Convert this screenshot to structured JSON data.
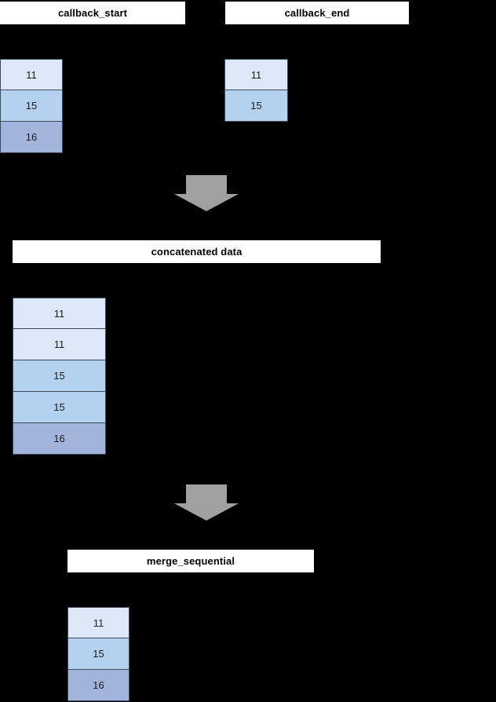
{
  "diagram": {
    "title_boxes": {
      "callback_start": "callback_start",
      "callback_end": "callback_end",
      "concatenated_data": "concatenated data",
      "merge_sequential": "merge_sequential"
    },
    "colors": {
      "background": "#000000",
      "box_fill": "#ffffff",
      "box_text": "#000000",
      "cell_border": "#3d4a5c",
      "cell_text": "#1a1a1a",
      "arrow_fill": "#a0a0a0",
      "shade_light": "#dce7f8",
      "shade_mid": "#b4d2ef",
      "shade_dark": "#a3b4dc"
    },
    "stacks": {
      "callback_start": {
        "name": "callback_start_stack",
        "cells": [
          {
            "value": "11",
            "fill": "#dce7f8"
          },
          {
            "value": "15",
            "fill": "#b4d2ef"
          },
          {
            "value": "16",
            "fill": "#a3b4dc"
          }
        ]
      },
      "callback_end": {
        "name": "callback_end_stack",
        "cells": [
          {
            "value": "11",
            "fill": "#dce7f8"
          },
          {
            "value": "15",
            "fill": "#b4d2ef"
          }
        ]
      },
      "concatenated": {
        "name": "concatenated_stack",
        "cells": [
          {
            "value": "11",
            "fill": "#dce7f8"
          },
          {
            "value": "11",
            "fill": "#dce7f8"
          },
          {
            "value": "15",
            "fill": "#b4d2ef"
          },
          {
            "value": "15",
            "fill": "#b4d2ef"
          },
          {
            "value": "16",
            "fill": "#a3b4dc"
          }
        ]
      },
      "merged": {
        "name": "merged_stack",
        "cells": [
          {
            "value": "11",
            "fill": "#dce7f8"
          },
          {
            "value": "15",
            "fill": "#b4d2ef"
          },
          {
            "value": "16",
            "fill": "#a3b4dc"
          }
        ]
      }
    },
    "arrows": [
      {
        "name": "arrow-concat-down",
        "direction": "down"
      },
      {
        "name": "arrow-merge-down",
        "direction": "down"
      }
    ]
  }
}
